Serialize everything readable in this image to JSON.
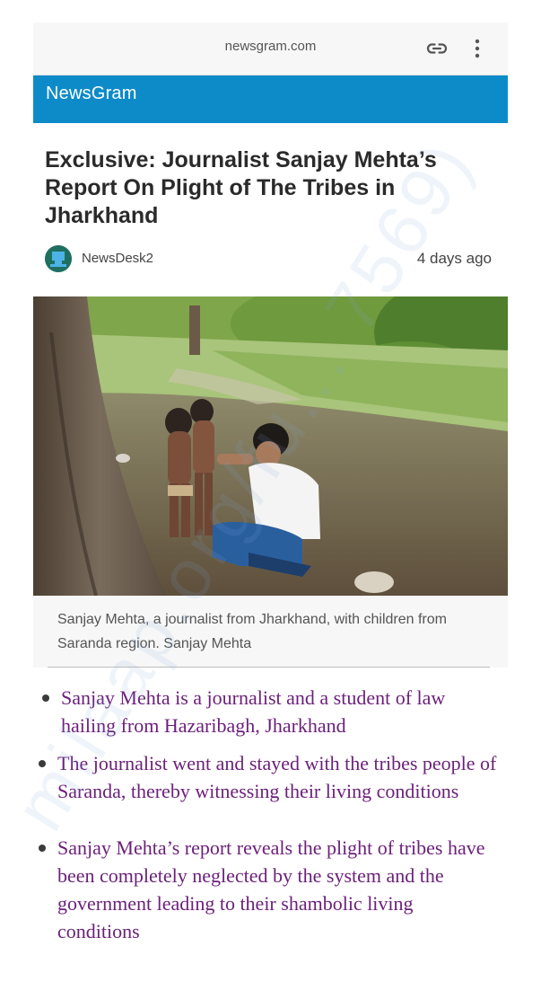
{
  "browser": {
    "url": "newsgram.com",
    "link_icon": "link-icon",
    "menu_icon": "more-vert-icon"
  },
  "site": {
    "name": "NewsGram",
    "header_color": "#0d8bc9"
  },
  "article": {
    "title": "Exclusive: Journalist Sanjay Mehta’s Report On Plight of The Tribes in Jharkhand",
    "author": "NewsDesk2",
    "time_ago": "4 days ago",
    "image_alt": "Sanjay Mehta with children in Saranda",
    "caption": "Sanjay Mehta, a journalist from Jharkhand, with children from Saranda region. Sanjay Mehta"
  },
  "bullets": [
    "Sanjay Mehta is a journalist and a student of law hailing from Hazaribagh, Jharkhand",
    "The journalist went and stayed with the tribes people of Saranda, thereby witnessing their living conditions",
    "Sanjay Mehta’s report reveals the plight of tribes have been completely neglected by the system and the government leading to their shambolic living conditions"
  ],
  "bullet_color": "#6b1f7a",
  "watermark": "milaap.org/fu... 7569)"
}
